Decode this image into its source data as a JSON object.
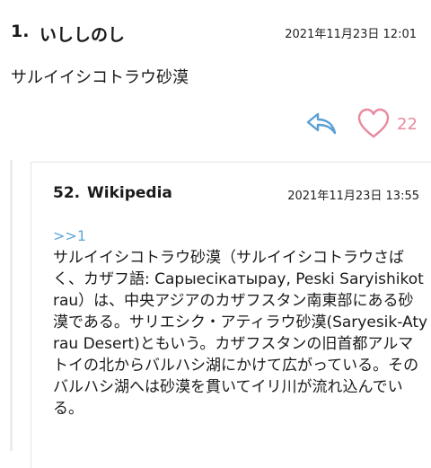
{
  "post1": {
    "number": "1.",
    "name": "いししのし",
    "date": "2021年11月23日 12:01",
    "body": "サルイイシコトラウ砂漠"
  },
  "actions": {
    "like_count": "22",
    "colors": {
      "reply": "#5a9fd4",
      "like": "#e88aa0"
    }
  },
  "post2": {
    "number": "52.",
    "name": "Wikipedia",
    "date": "2021年11月23日 13:55",
    "anchor": ">>1",
    "body": "サルイイシコトラウ砂漠（サルイイシコトラウさばく、カザフ語: Сарыесікатырау, Peski Saryishikotrau）は、中央アジアのカザフスタン南東部にある砂漠である。サリエシク・アティラウ砂漠(Saryesik-Atyrau Desert)ともいう。カザフスタンの旧首都アルマトイの北からバルハシ湖にかけて広がっている。そのバルハシ湖へは砂漠を貫いてイリ川が流れ込んでいる。"
  }
}
